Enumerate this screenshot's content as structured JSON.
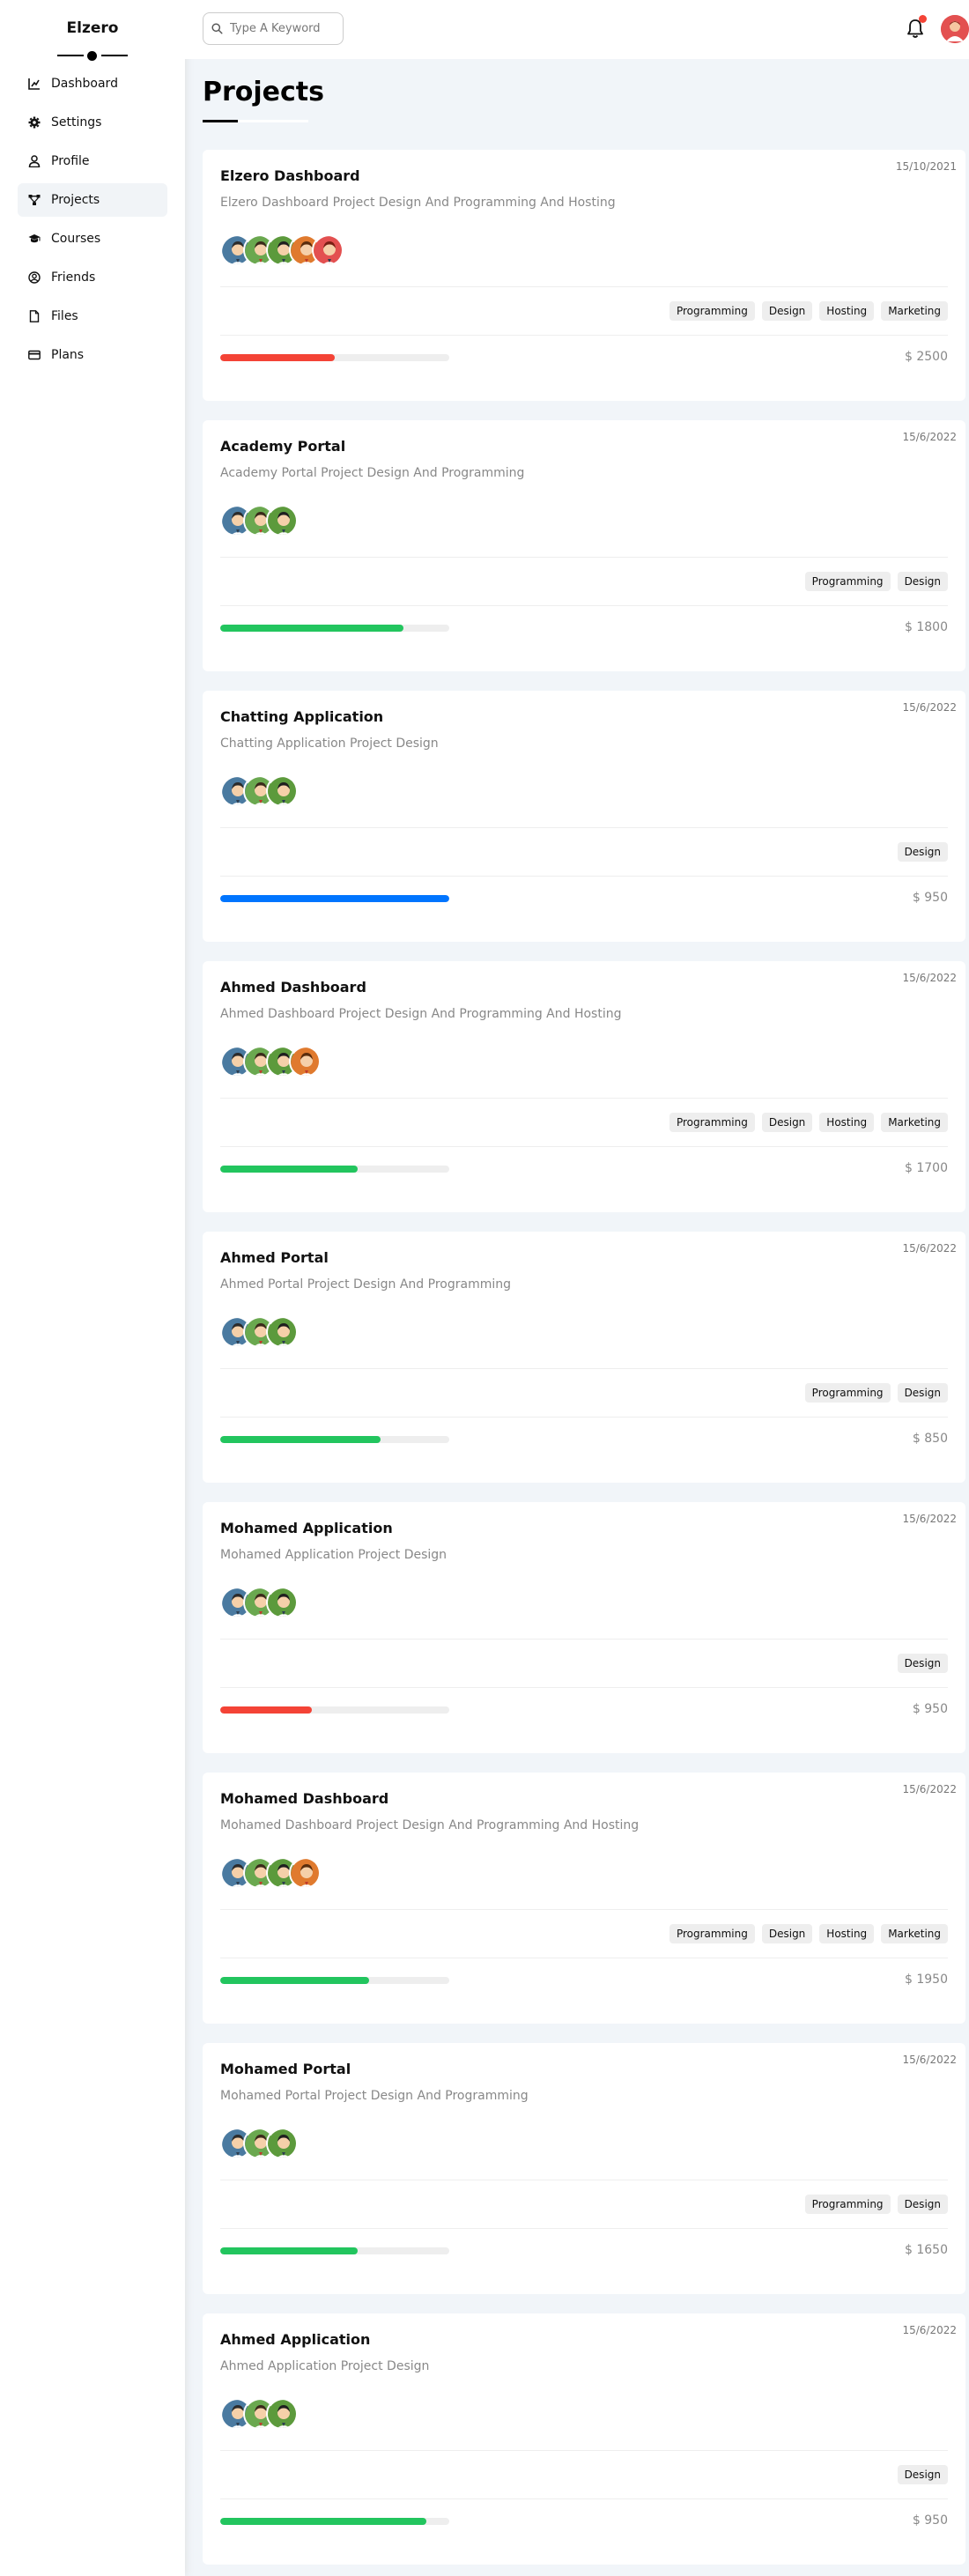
{
  "brand": "Elzero",
  "sidebar": {
    "items": [
      {
        "label": "Dashboard",
        "icon": "chart-icon",
        "active": false
      },
      {
        "label": "Settings",
        "icon": "gear-icon",
        "active": false
      },
      {
        "label": "Profile",
        "icon": "user-icon",
        "active": false
      },
      {
        "label": "Projects",
        "icon": "diagram-icon",
        "active": true
      },
      {
        "label": "Courses",
        "icon": "graduation-cap-icon",
        "active": false
      },
      {
        "label": "Friends",
        "icon": "user-circle-icon",
        "active": false
      },
      {
        "label": "Files",
        "icon": "file-icon",
        "active": false
      },
      {
        "label": "Plans",
        "icon": "credit-card-icon",
        "active": false
      }
    ]
  },
  "header": {
    "search_placeholder": "Type A Keyword",
    "notification_icon": "bell-icon",
    "has_notification": true
  },
  "main": {
    "title": "Projects"
  },
  "colors": {
    "red": "#f44336",
    "green": "#22c55e",
    "blue": "#0075ff",
    "avatar_bg": [
      "#4a7aa0",
      "#6aa84f",
      "#5c9a3c",
      "#e07a2e",
      "#e35050"
    ]
  },
  "projects": [
    {
      "title": "Elzero Dashboard",
      "date": "15/10/2021",
      "desc": "Elzero Dashboard Project Design And Programming And Hosting",
      "members": 5,
      "tags": [
        "Programming",
        "Design",
        "Hosting",
        "Marketing"
      ],
      "progress": 50,
      "color": "red",
      "price": "$ 2500"
    },
    {
      "title": "Academy Portal",
      "date": "15/6/2022",
      "desc": "Academy Portal Project Design And Programming",
      "members": 3,
      "tags": [
        "Programming",
        "Design"
      ],
      "progress": 80,
      "color": "green",
      "price": "$ 1800"
    },
    {
      "title": "Chatting Application",
      "date": "15/6/2022",
      "desc": "Chatting Application Project Design",
      "members": 3,
      "tags": [
        "Design"
      ],
      "progress": 100,
      "color": "blue",
      "price": "$ 950"
    },
    {
      "title": "Ahmed Dashboard",
      "date": "15/6/2022",
      "desc": "Ahmed Dashboard Project Design And Programming And Hosting",
      "members": 4,
      "tags": [
        "Programming",
        "Design",
        "Hosting",
        "Marketing"
      ],
      "progress": 60,
      "color": "green",
      "price": "$ 1700"
    },
    {
      "title": "Ahmed Portal",
      "date": "15/6/2022",
      "desc": "Ahmed Portal Project Design And Programming",
      "members": 3,
      "tags": [
        "Programming",
        "Design"
      ],
      "progress": 70,
      "color": "green",
      "price": "$ 850"
    },
    {
      "title": "Mohamed Application",
      "date": "15/6/2022",
      "desc": "Mohamed Application Project Design",
      "members": 3,
      "tags": [
        "Design"
      ],
      "progress": 40,
      "color": "red",
      "price": "$ 950"
    },
    {
      "title": "Mohamed Dashboard",
      "date": "15/6/2022",
      "desc": "Mohamed Dashboard Project Design And Programming And Hosting",
      "members": 4,
      "tags": [
        "Programming",
        "Design",
        "Hosting",
        "Marketing"
      ],
      "progress": 65,
      "color": "green",
      "price": "$ 1950"
    },
    {
      "title": "Mohamed Portal",
      "date": "15/6/2022",
      "desc": "Mohamed Portal Project Design And Programming",
      "members": 3,
      "tags": [
        "Programming",
        "Design"
      ],
      "progress": 60,
      "color": "green",
      "price": "$ 1650"
    },
    {
      "title": "Ahmed Application",
      "date": "15/6/2022",
      "desc": "Ahmed Application Project Design",
      "members": 3,
      "tags": [
        "Design"
      ],
      "progress": 90,
      "color": "green",
      "price": "$ 950"
    }
  ]
}
